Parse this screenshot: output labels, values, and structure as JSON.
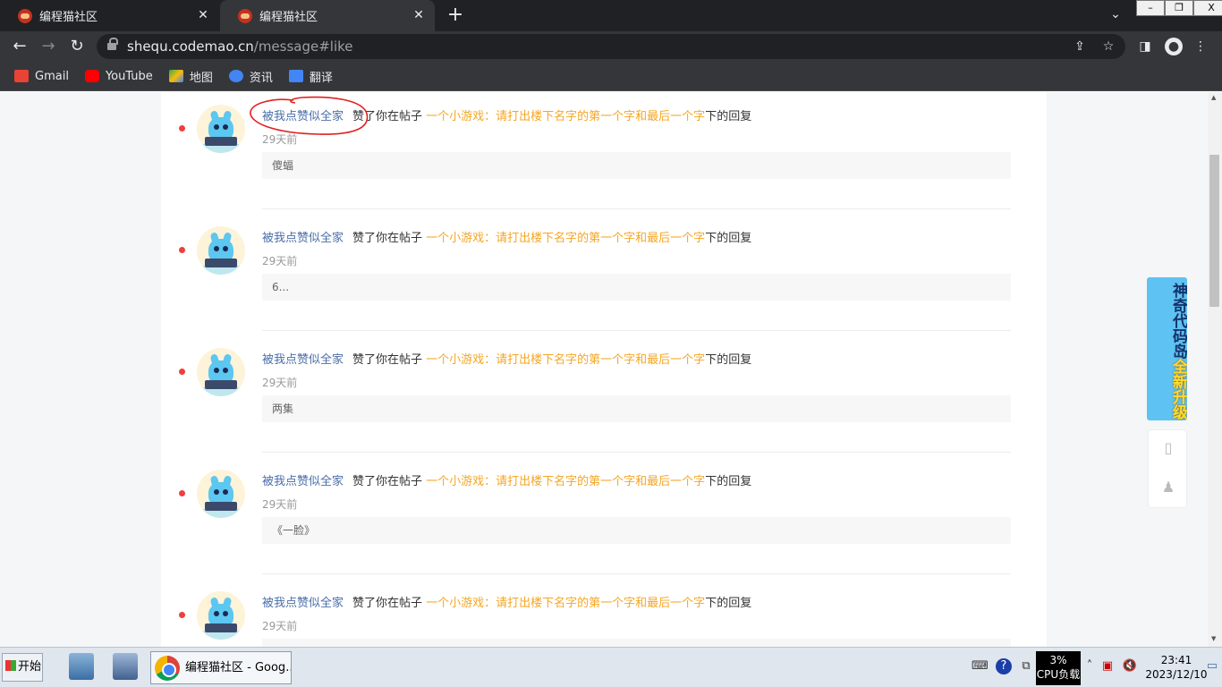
{
  "browser": {
    "tabs": [
      {
        "title": "编程猫社区",
        "active": false
      },
      {
        "title": "编程猫社区",
        "active": true
      }
    ],
    "new_tab": "+",
    "url_host": "shequ.codemao.cn",
    "url_path": "/message#like",
    "window_buttons": {
      "minimize": "–",
      "restore": "❐",
      "close": "X"
    },
    "bookmarks": [
      {
        "label": "Gmail",
        "icon": "gmail-icon",
        "color": "#ea4335"
      },
      {
        "label": "YouTube",
        "icon": "youtube-icon",
        "color": "#ff0000"
      },
      {
        "label": "地图",
        "icon": "maps-icon",
        "color": "#34a853"
      },
      {
        "label": "资讯",
        "icon": "news-icon",
        "color": "#4285f4"
      },
      {
        "label": "翻译",
        "icon": "translate-icon",
        "color": "#4285f4"
      }
    ]
  },
  "notifications": [
    {
      "user": "被我点赞似全家",
      "verb": "赞了你在帖子",
      "post": "一个小游戏：请打出楼下名字的第一个字和最后一个字",
      "suffix": "下的回复",
      "time": "29天前",
      "quote": "傻蝠"
    },
    {
      "user": "被我点赞似全家",
      "verb": "赞了你在帖子",
      "post": "一个小游戏：请打出楼下名字的第一个字和最后一个字",
      "suffix": "下的回复",
      "time": "29天前",
      "quote": "6..."
    },
    {
      "user": "被我点赞似全家",
      "verb": "赞了你在帖子",
      "post": "一个小游戏：请打出楼下名字的第一个字和最后一个字",
      "suffix": "下的回复",
      "time": "29天前",
      "quote": "两集"
    },
    {
      "user": "被我点赞似全家",
      "verb": "赞了你在帖子",
      "post": "一个小游戏：请打出楼下名字的第一个字和最后一个字",
      "suffix": "下的回复",
      "time": "29天前",
      "quote": "《一脸》"
    },
    {
      "user": "被我点赞似全家",
      "verb": "赞了你在帖子",
      "post": "一个小游戏：请打出楼下名字的第一个字和最后一个字",
      "suffix": "下的回复",
      "time": "29天前",
      "quote": ""
    }
  ],
  "promo": {
    "line1": "神奇代码岛",
    "line2": "全新升级"
  },
  "taskbar": {
    "start": "开始",
    "app_title": "编程猫社区 - Goog...",
    "cpu_percent": "3%",
    "cpu_label": "CPU负载",
    "time": "23:41",
    "date": "2023/12/10"
  },
  "colors": {
    "user_link": "#4a6ea9",
    "post_link": "#f5a623",
    "unread_dot": "#f03e3e",
    "annotation": "#e02020"
  }
}
